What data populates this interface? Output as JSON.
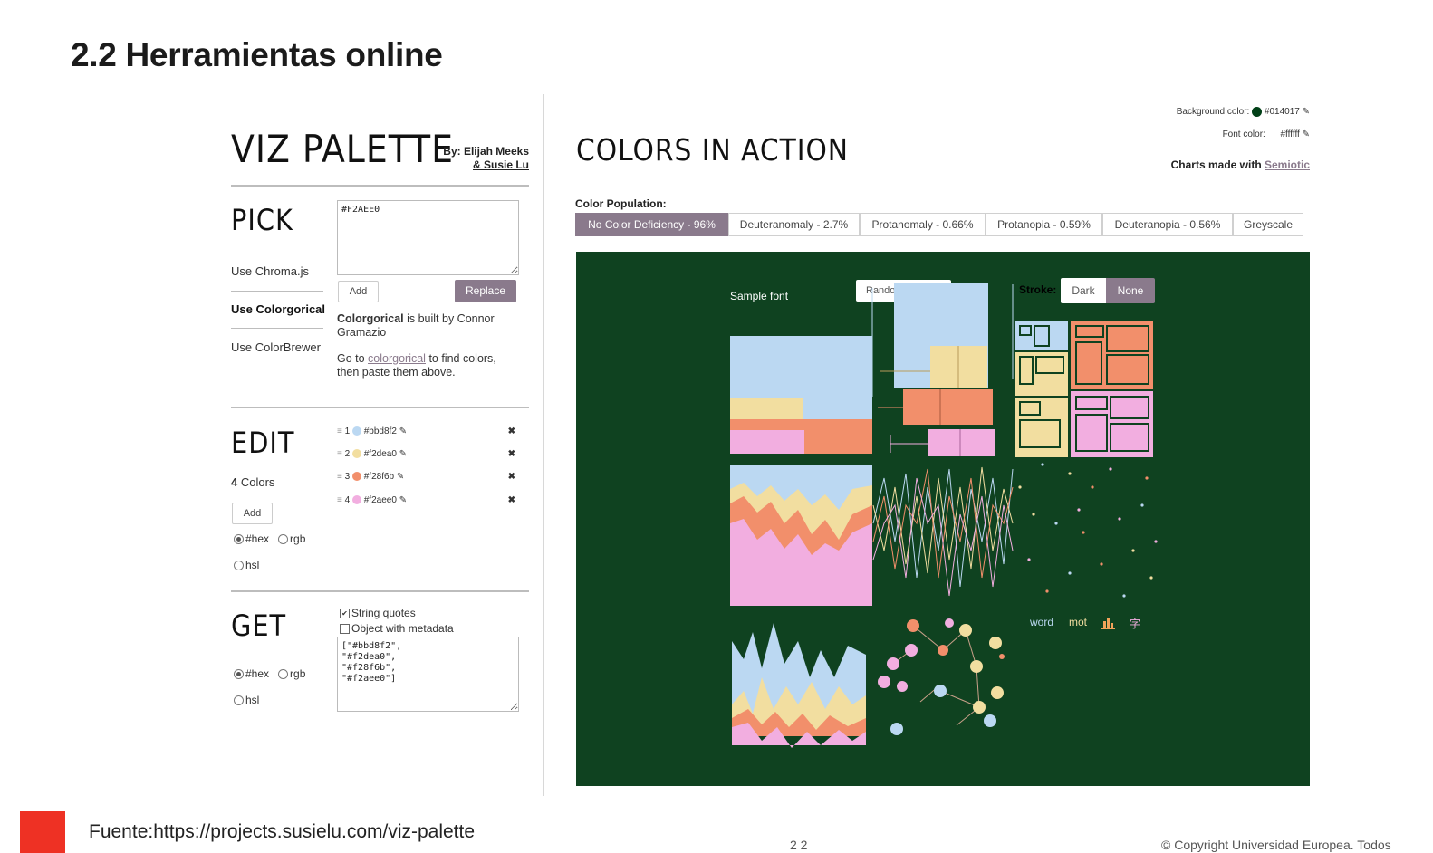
{
  "slide": {
    "title": "2.2 Herramientas online",
    "source": "Fuente:https://projects.susielu.com/viz-palette",
    "page_fragment": "2 2",
    "copyright": "© Copyright Universidad Europea. Todos",
    "accent_color": "#ee3124"
  },
  "left": {
    "app_title": "VIZ PALETTE",
    "byline_1": "By: Elijah Meeks",
    "byline_2": "& Susie Lu",
    "pick": {
      "heading": "PICK",
      "textarea_value": "#F2AEE0",
      "nav": [
        "Use Chroma.js",
        "Use Colorgorical",
        "Use ColorBrewer"
      ],
      "add_label": "Add",
      "replace_label": "Replace",
      "desc_bold": "Colorgorical",
      "desc_rest": " is built by Connor Gramazio",
      "goto_prefix": "Go to ",
      "goto_link": "colorgorical",
      "goto_suffix": " to find colors, then paste them above."
    },
    "edit": {
      "heading": "EDIT",
      "count": "4",
      "count_label": " Colors",
      "add_label": "Add",
      "opt_hex": "#hex",
      "opt_rgb": "rgb",
      "opt_hsl": "hsl",
      "colors": [
        {
          "index": "1",
          "hex": "#bbd8f2"
        },
        {
          "index": "2",
          "hex": "#f2dea0"
        },
        {
          "index": "3",
          "hex": "#f28f6b"
        },
        {
          "index": "4",
          "hex": "#f2aee0"
        }
      ]
    },
    "get": {
      "heading": "GET",
      "opt_string_quotes": "String quotes",
      "opt_object": "Object with metadata",
      "output": "[\"#bbd8f2\",\n\"#f2dea0\",\n\"#f28f6b\",\n\"#f2aee0\"]",
      "opt_hex": "#hex",
      "opt_rgb": "rgb",
      "opt_hsl": "hsl"
    }
  },
  "right": {
    "title": "COLORS IN ACTION",
    "bg_label": "Background color:",
    "bg_value": "#014017",
    "bg_color": "#014017",
    "font_label": "Font color:",
    "font_value": "#ffffff",
    "charts_made": "Charts made with ",
    "charts_link": "Semiotic",
    "population_label": "Color Population:",
    "tabs": [
      "No Color Deficiency - 96%",
      "Deuteranomaly - 2.7%",
      "Protanomaly - 0.66%",
      "Protanopia - 0.59%",
      "Deuteranopia - 0.56%",
      "Greyscale"
    ],
    "sample_font": "Sample font",
    "random_btn": "Rando",
    "stroke_label": "Stroke:",
    "stroke_dark": "Dark",
    "stroke_none": "None",
    "words": [
      "word",
      "mot",
      "字"
    ]
  }
}
